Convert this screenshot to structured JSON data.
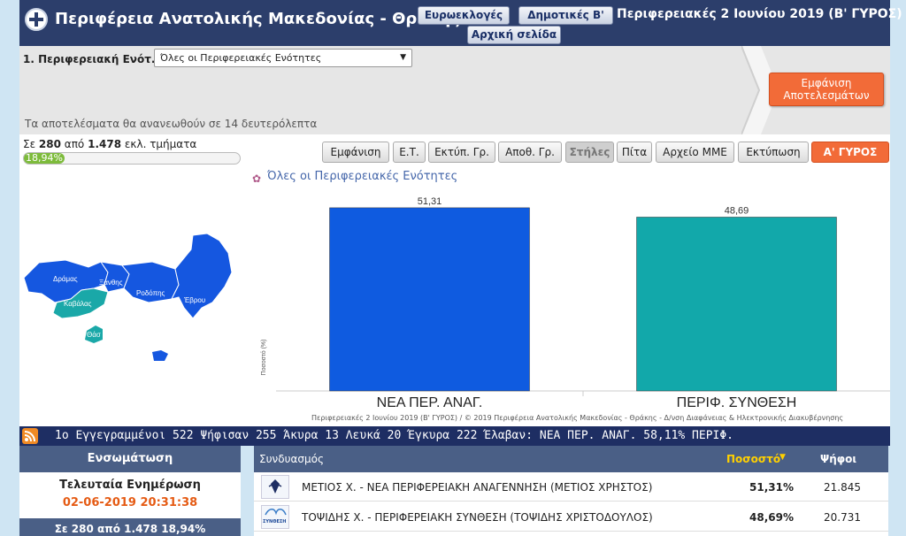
{
  "header": {
    "title": "Περιφέρεια Ανατολικής Μακεδονίας - Θράκης",
    "buttons": {
      "euro": "Ευρωεκλογές",
      "dimotikes": "Δημοτικές Β'",
      "home": "Αρχική σελίδα"
    },
    "election": "Περιφερειακές 2 Ιουνίου 2019 (Β' ΓΥΡΟΣ)"
  },
  "selector": {
    "label": "1. Περιφερειακή Ενότ.:",
    "value": "Όλες οι Περιφερειακές Ενότητες",
    "refresh_note": "Τα αποτελέσματα θα ανανεωθούν σε 14 δευτερόλεπτα",
    "show_results": "Εμφάνιση Αποτελεσμάτων"
  },
  "counts": {
    "pre": "Σε",
    "counted": "280",
    "mid": "από",
    "total": "1.478",
    "post": "εκλ. τμήματα",
    "percent": "18,94%",
    "progress": 0.1894
  },
  "tabs": [
    "Εμφάνιση",
    "Ε.Τ.",
    "Εκτύπ. Γρ.",
    "Αποθ. Γρ.",
    "Στήλες",
    "Πίτα",
    "Αρχείο ΜΜΕ",
    "Εκτύπωση",
    "Α' ΓΥΡΟΣ"
  ],
  "map": {
    "regions": [
      "Δράμας",
      "Ξάνθης",
      "Ροδόπης",
      "Έβρου",
      "Καβάλας",
      "Θάσ"
    ],
    "colors": {
      "blue": "#1557e0",
      "teal": "#1aa8a8"
    }
  },
  "chart_data": {
    "type": "bar",
    "title": "Όλες οι Περιφερειακές Ενότητες",
    "categories": [
      "ΝΕΑ ΠΕΡ. ΑΝΑΓ.",
      "ΠΕΡΙΦ. ΣΥΝΘΕΣΗ"
    ],
    "values": [
      51.31,
      48.69
    ],
    "value_labels": [
      "51,31",
      "48,69"
    ],
    "colors": [
      "#0f5be0",
      "#12a8aa"
    ],
    "ylabel": "Ποσοστό (%)",
    "ylim": [
      0,
      55
    ],
    "credit": "Περιφερειακές 2 Ιουνίου 2019 (Β' ΓΥΡΟΣ) / © 2019 Περιφέρεια Ανατολικής Μακεδονίας - Θράκης - Δ/νση Διαφάνειας & Ηλεκτρονικής Διακυβέρνησης"
  },
  "ticker": {
    "text": "1ο  Εγγεγραμμένοι 522  Ψήφισαν 255  Άκυρα 13  Λευκά 20  Έγκυρα 222  Έλαβαν: ΝΕΑ ΠΕΡ. ΑΝΑΓ. 58,11%  ΠΕΡΙΦ."
  },
  "left_panel": {
    "header": "Ενσωμάτωση",
    "update_label": "Τελευταία Ενημέρωση",
    "update_time": "02-06-2019 20:31:38",
    "footer": "Σε 280 από  1.478   18,94%"
  },
  "results_table": {
    "headers": {
      "combination": "Συνδυασμός",
      "percent": "Ποσοστό",
      "votes": "Ψήφοι"
    },
    "rows": [
      {
        "name": "ΜΕΤΙΟΣ Χ. - ΝΕΑ ΠΕΡΙΦΕΡΕΙΑΚΗ ΑΝΑΓΕΝΝΗΣΗ (ΜΕΤΙΟΣ ΧΡΗΣΤΟΣ)",
        "percent": "51,31%",
        "votes": "21.845"
      },
      {
        "name": "ΤΟΨΙΔΗΣ Χ. - ΠΕΡΙΦΕΡΕΙΑΚΗ ΣΥΝΘΕΣΗ (ΤΟΨΙΔΗΣ ΧΡΙΣΤΟΔΟΥΛΟΣ)",
        "percent": "48,69%",
        "votes": "20.731",
        "logo_text": "ΣΥΝΘΕΣΗ"
      }
    ]
  }
}
